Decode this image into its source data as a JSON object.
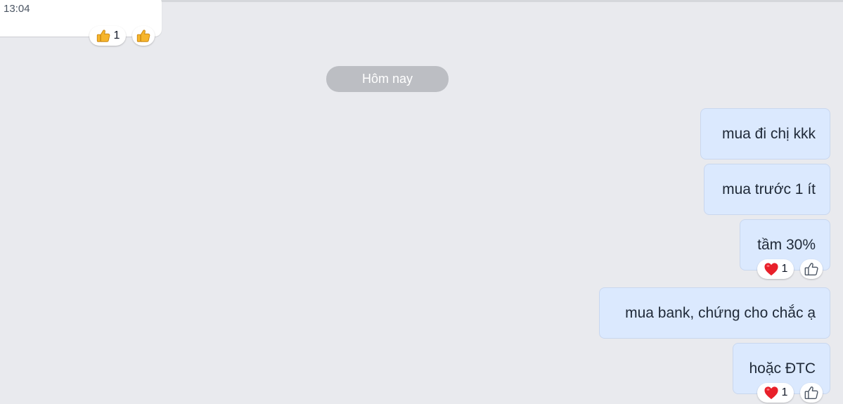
{
  "previous_message": {
    "time": "13:04",
    "reaction_count": "1",
    "reaction_icon": "thumbs-up-emoji",
    "quick_react_icon": "thumbs-up-emoji"
  },
  "date_separator": "Hôm nay",
  "messages": [
    {
      "text": "mua đi chị kkk"
    },
    {
      "text": "mua trước 1 ít"
    },
    {
      "text": "tầm 30%",
      "reaction_icon": "heart-emoji",
      "reaction_count": "1",
      "quick_react_icon": "thumbs-up-outline-icon"
    },
    {
      "text": "mua bank, chứng cho chắc ạ"
    },
    {
      "text": "hoặc ĐTC",
      "reaction_icon": "heart-emoji",
      "reaction_count": "1",
      "quick_react_icon": "thumbs-up-outline-icon"
    }
  ],
  "colors": {
    "background": "#e9eaee",
    "outgoing_bubble": "#dbe9fe",
    "incoming_bubble": "#ffffff",
    "date_chip": "#bcbec3",
    "heart": "#e8202a",
    "thumb_emoji": "#f6b52c"
  }
}
